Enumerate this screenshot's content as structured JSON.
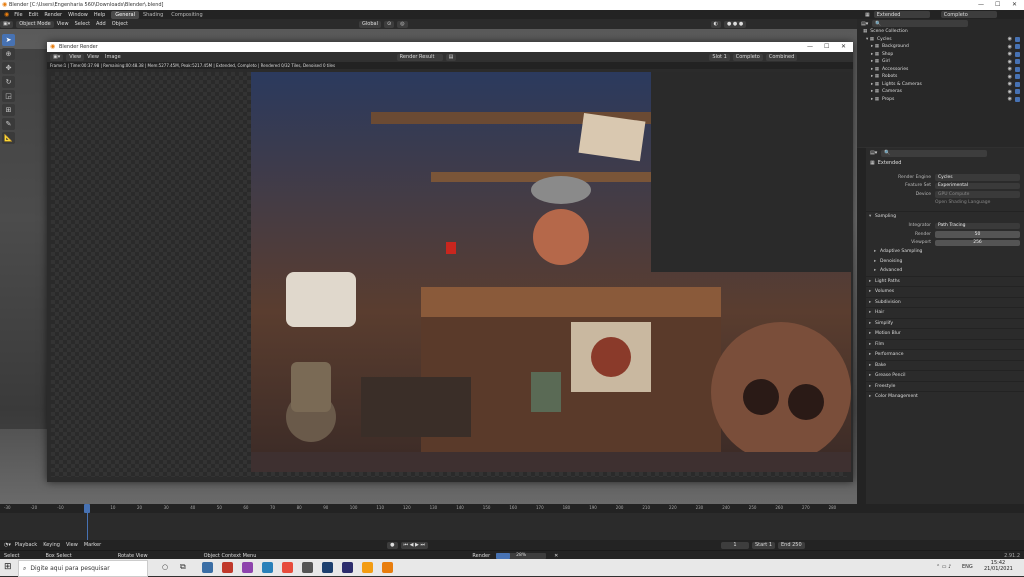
{
  "window_title": "Blender [C:\\Users\\Engenharia 560\\Downloads\\Blender\\.blend]",
  "menu": [
    "File",
    "Edit",
    "Render",
    "Window",
    "Help"
  ],
  "workspaces": [
    "General",
    "Shading",
    "Compositing"
  ],
  "view_header": {
    "mode": "Object Mode",
    "items": [
      "View",
      "Select",
      "Add",
      "Object"
    ],
    "transform": "Global"
  },
  "render_window": {
    "title": "Blender Render",
    "menu": [
      "View",
      "View",
      "Image"
    ],
    "image_name": "Render Result",
    "slot": "Slot 1",
    "layer": "Completo",
    "pass": "Combined",
    "status": "Frame:1 | Time:00:37.98 | Remaining:00:48.38 | Mem:5277.45M, Peak:5217.45M | Extended, Completo | Rendered 0/32 Tiles, Denoised 0 tiles"
  },
  "top_right": {
    "scene": "Extended",
    "view_layer": "Completo"
  },
  "outliner": {
    "title": "Scene Collection",
    "items": [
      "Cycles",
      "Background",
      "Shop",
      "Girl",
      "Accessories",
      "Robots",
      "Lights & Cameras",
      "Cameras",
      "Props"
    ]
  },
  "properties": {
    "scene_name": "Extended",
    "render_engine_label": "Render Engine",
    "render_engine": "Cycles",
    "feature_set_label": "Feature Set",
    "feature_set": "Experimental",
    "device_label": "Device",
    "device": "GPU Compute",
    "osl": "Open Shading Language",
    "sampling": "Sampling",
    "integrator_label": "Integrator",
    "integrator": "Path Tracing",
    "render_samples_label": "Render",
    "render_samples": "50",
    "viewport_samples_label": "Viewport",
    "viewport_samples": "256",
    "subpanels": [
      "Adaptive Sampling",
      "Denoising",
      "Advanced"
    ],
    "panels": [
      "Light Paths",
      "Volumes",
      "Subdivision",
      "Hair",
      "Simplify",
      "Motion Blur",
      "Film",
      "Performance",
      "Bake",
      "Grease Pencil",
      "Freestyle",
      "Color Management"
    ]
  },
  "timeline": {
    "ticks": [
      "-30",
      "-20",
      "-10",
      "1",
      "10",
      "20",
      "30",
      "40",
      "50",
      "60",
      "70",
      "80",
      "90",
      "100",
      "110",
      "120",
      "130",
      "140",
      "150",
      "160",
      "170",
      "180",
      "190",
      "200",
      "210",
      "220",
      "230",
      "240",
      "250",
      "260",
      "270",
      "280"
    ],
    "current_frame": "1",
    "controls": [
      "Playback",
      "Keying",
      "View",
      "Marker"
    ],
    "frame": "1",
    "start_label": "Start",
    "start": "1",
    "end_label": "End",
    "end": "250"
  },
  "statusbar": {
    "items": [
      "Select",
      "Box Select",
      "Rotate View",
      "Object Context Menu"
    ],
    "render_label": "Render",
    "render_progress": "28%",
    "render_fraction": 0.28,
    "version": "2.91.2"
  },
  "taskbar": {
    "search_placeholder": "Digite aqui para pesquisar",
    "time": "15:42",
    "date": "21/01/2021",
    "lang": "ENG"
  }
}
